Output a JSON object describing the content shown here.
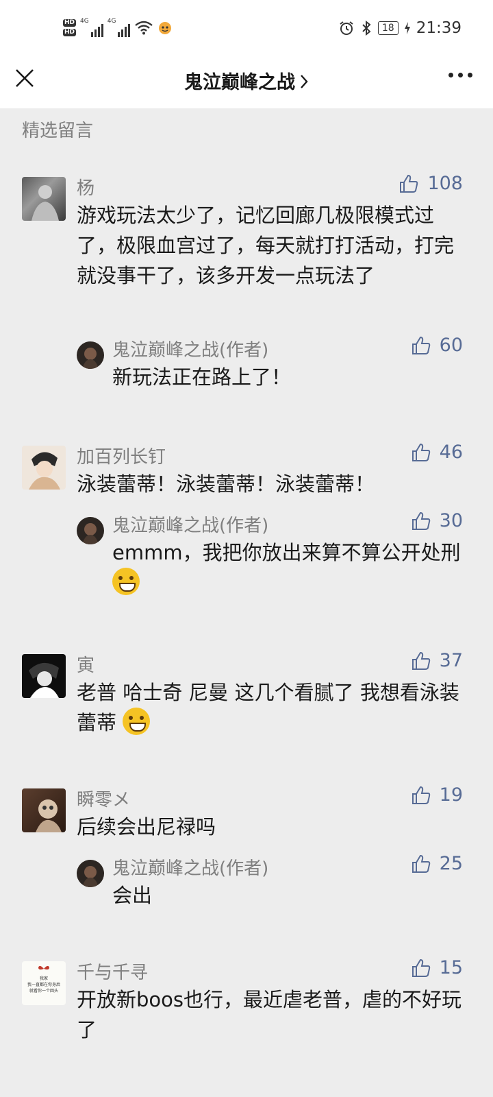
{
  "status_bar": {
    "hd1": "HD",
    "hd2": "HD",
    "net1": "4G",
    "net2": "4G",
    "battery": "18",
    "time": "21:39"
  },
  "header": {
    "title": "鬼泣巅峰之战"
  },
  "section_title": "精选留言",
  "comments": [
    {
      "name": "杨",
      "likes": "108",
      "text": "游戏玩法太少了，记忆回廊几极限模式过了，极限血宫过了，每天就打打活动，打完就没事干了，该多开发一点玩法了",
      "reply": {
        "name": "鬼泣巅峰之战(作者)",
        "likes": "60",
        "text": "新玩法正在路上了！"
      }
    },
    {
      "name": "加百列长钉",
      "likes": "46",
      "text": "泳装蕾蒂！泳装蕾蒂！泳装蕾蒂！",
      "reply": {
        "name": "鬼泣巅峰之战(作者)",
        "likes": "30",
        "text": "emmm，我把你放出来算不算公开处刑"
      }
    },
    {
      "name": "寅",
      "likes": "37",
      "text": "老普 哈士奇 尼曼 这几个看腻了 我想看泳装蕾蒂"
    },
    {
      "name": "瞬零メ",
      "likes": "19",
      "text": "后续会出尼禄吗",
      "reply": {
        "name": "鬼泣巅峰之战(作者)",
        "likes": "25",
        "text": "会出"
      }
    },
    {
      "name": "千与千寻",
      "likes": "15",
      "text": "开放新boos也行，最近虐老普，虐的不好玩了",
      "avatar_text": [
        "我家",
        "我一直都在你身后",
        "就看你一个回头"
      ]
    }
  ],
  "colors": {
    "link": "#576b95",
    "secondary": "#7f7f7f",
    "background": "#ededed"
  }
}
